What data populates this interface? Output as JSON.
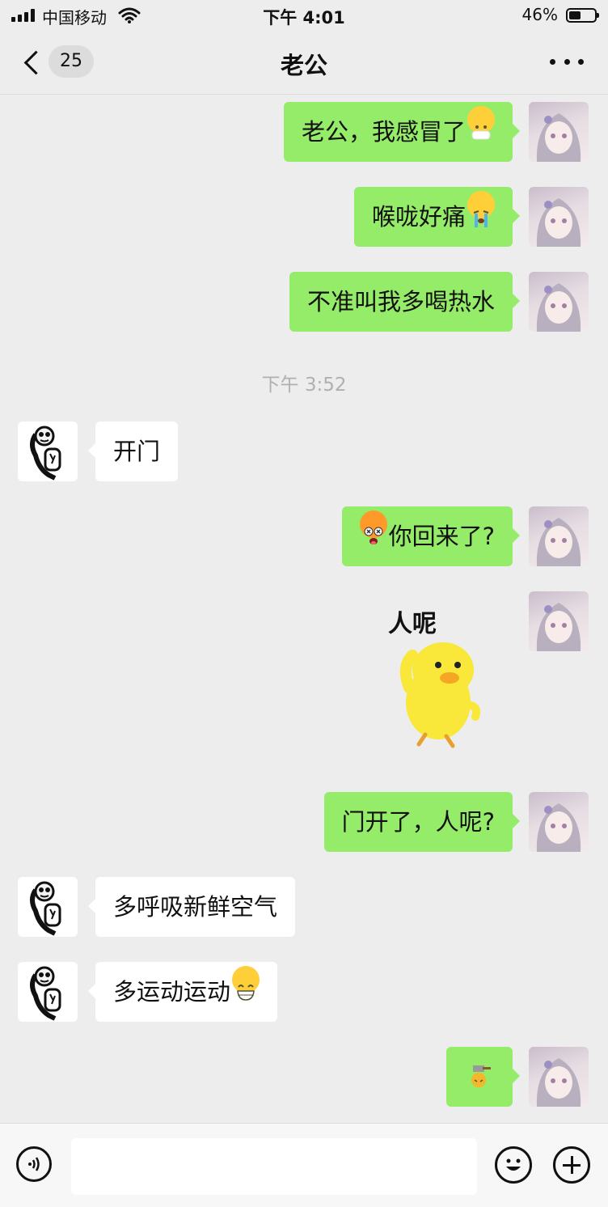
{
  "status_bar": {
    "carrier": "中国移动",
    "time": "下午 4:01",
    "battery": "46%",
    "battery_level": 0.46
  },
  "header": {
    "unread_count": "25",
    "title": "老公"
  },
  "messages": [
    {
      "from": "me",
      "text": "老公，我感冒了",
      "emoji": "mask-face-emoji"
    },
    {
      "from": "me",
      "text": "喉咙好痛",
      "emoji": "crying-face-emoji"
    },
    {
      "from": "me",
      "text": "不准叫我多喝热水"
    },
    {
      "timestamp": "下午 3:52"
    },
    {
      "from": "him",
      "text": "开门"
    },
    {
      "from": "me",
      "text": "你回来了?",
      "emoji": "dizzy-face-emoji"
    },
    {
      "from": "me",
      "sticker": "yellow-duck-sticker",
      "caption": "人呢"
    },
    {
      "from": "me",
      "text": "门开了，人呢?"
    },
    {
      "from": "him",
      "text": "多呼吸新鲜空气"
    },
    {
      "from": "him",
      "text": "多运动运动",
      "emoji": "grinning-face-emoji"
    },
    {
      "from": "me",
      "emoji": "hammer-head-emoji"
    }
  ],
  "icons": {
    "back": "chevron-left-icon",
    "more": "more-dots-icon",
    "voice": "voice-icon",
    "emoji": "emoji-icon",
    "add": "plus-icon"
  },
  "colors": {
    "background": "#ededed",
    "outgoing_bubble": "#95ec69",
    "incoming_bubble": "#ffffff",
    "timestamp": "#b0b0b0"
  },
  "input": {
    "value": "",
    "placeholder": ""
  }
}
